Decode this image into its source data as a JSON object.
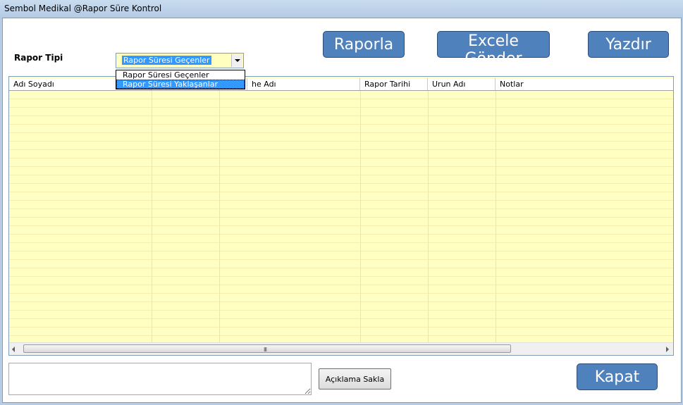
{
  "window": {
    "title": "Sembol Medikal  @Rapor Süre Kontrol"
  },
  "toolbar": {
    "raporla_label": "Raporla",
    "excel_label": "Excele Gönder",
    "yazdir_label": "Yazdır"
  },
  "filter": {
    "label": "Rapor Tipi",
    "selected": "Rapor Süresi Geçenler",
    "options": [
      "Rapor Süresi Geçenler",
      "Rapor Süresi Yaklaşanlar"
    ],
    "highlighted_option": 1
  },
  "grid": {
    "columns": [
      "Adı Soyadı",
      "",
      "",
      "he Adı",
      "Rapor Tarihi",
      "Urun Adı",
      "Notlar"
    ],
    "rows": [],
    "scroll_grip": "III"
  },
  "footer": {
    "save_note_label": "Açıklama Sakla",
    "close_label": "Kapat",
    "note_value": ""
  },
  "colors": {
    "grid_background": "#fffdb8",
    "button_blue": "#4f81bd",
    "selection_blue": "#3399ff"
  }
}
